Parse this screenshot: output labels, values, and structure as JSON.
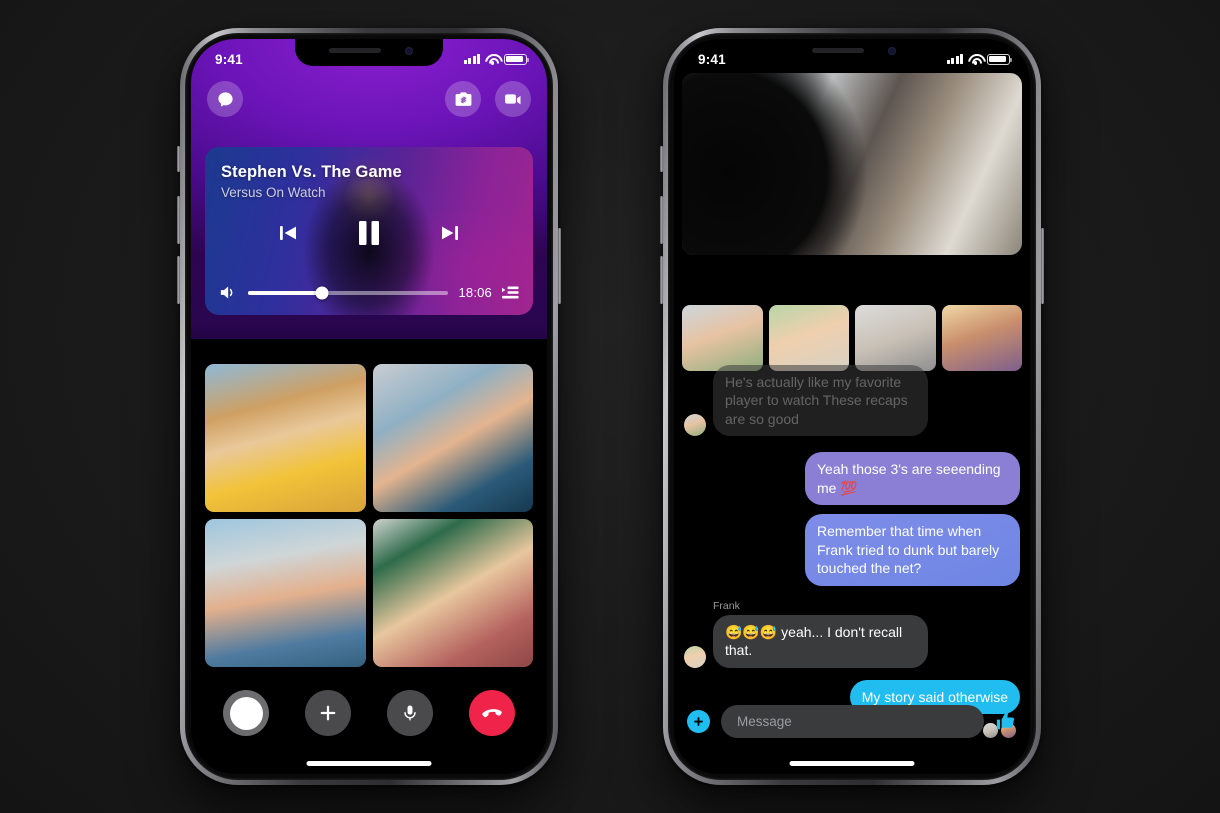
{
  "meta": {
    "background_color": "#1b1b1b",
    "accent_cyan": "#22bdf0",
    "accent_red": "#f0234a",
    "accent_purple": "#8a1fd0"
  },
  "left_phone": {
    "status_bar": {
      "time": "9:41",
      "cellular_icon": "signal-bars-icon",
      "wifi_icon": "wifi-icon",
      "battery_icon": "battery-icon"
    },
    "header": {
      "chat_icon": "chat-bubble-icon",
      "flip_camera_icon": "flip-camera-icon",
      "video_icon": "video-camera-icon"
    },
    "player": {
      "title": "Stephen Vs. The Game",
      "subtitle": "Versus On Watch",
      "previous_icon": "skip-previous-icon",
      "pause_icon": "pause-icon",
      "next_icon": "skip-next-icon",
      "volume_icon": "volume-icon",
      "time_remaining": "18:06",
      "queue_icon": "play-queue-icon",
      "progress_percent": 37
    },
    "participants": [
      {
        "name": "participant-1",
        "photo_class": "p1"
      },
      {
        "name": "participant-2",
        "photo_class": "p2"
      },
      {
        "name": "participant-3",
        "photo_class": "p3"
      },
      {
        "name": "participant-4",
        "photo_class": "p4"
      }
    ],
    "call_controls": [
      {
        "name": "camera-shutter-button",
        "icon": "shutter-icon"
      },
      {
        "name": "add-participant-button",
        "icon": "plus-icon"
      },
      {
        "name": "mute-button",
        "icon": "microphone-icon"
      },
      {
        "name": "end-call-button",
        "icon": "end-call-icon"
      }
    ],
    "home_indicator": "home-indicator"
  },
  "right_phone": {
    "status_bar": {
      "time": "9:41",
      "cellular_icon": "signal-bars-icon",
      "wifi_icon": "wifi-icon",
      "battery_icon": "battery-icon"
    },
    "hero_video": {
      "name": "hero-video-tile"
    },
    "thumbnails": [
      {
        "name": "thumbnail-1",
        "photo_class": "pav1"
      },
      {
        "name": "thumbnail-2",
        "photo_class": "pav2"
      },
      {
        "name": "thumbnail-3",
        "photo_class": "pav3"
      },
      {
        "name": "thumbnail-4",
        "photo_class": "pav4"
      }
    ],
    "messages": [
      {
        "id": "m1",
        "direction": "in",
        "style": "faded",
        "sender": "",
        "avatar": true,
        "text": "He's actually like my favorite player to watch These recaps are so good"
      },
      {
        "id": "m2",
        "direction": "out",
        "style": "out-purple",
        "sender": "",
        "avatar": false,
        "text": "Yeah those 3's are seeending me 💯"
      },
      {
        "id": "m3",
        "direction": "out",
        "style": "out-blue",
        "sender": "",
        "avatar": false,
        "text": "Remember that time when Frank tried to dunk but barely touched the net?"
      },
      {
        "id": "m4",
        "direction": "in",
        "style": "in",
        "sender": "Frank",
        "avatar": true,
        "text": "😅😅😅 yeah... I don't recall that."
      },
      {
        "id": "m5",
        "direction": "out",
        "style": "out-cyan",
        "sender": "",
        "avatar": false,
        "text": "My story said otherwise"
      }
    ],
    "read_receipts": [
      {
        "name": "read-receipt-avatar-1"
      },
      {
        "name": "read-receipt-avatar-2"
      }
    ],
    "composer": {
      "add_icon": "plus-circle-icon",
      "input_placeholder": "Message",
      "input_value": "",
      "like_icon": "thumbs-up-icon"
    },
    "home_indicator": "home-indicator"
  }
}
